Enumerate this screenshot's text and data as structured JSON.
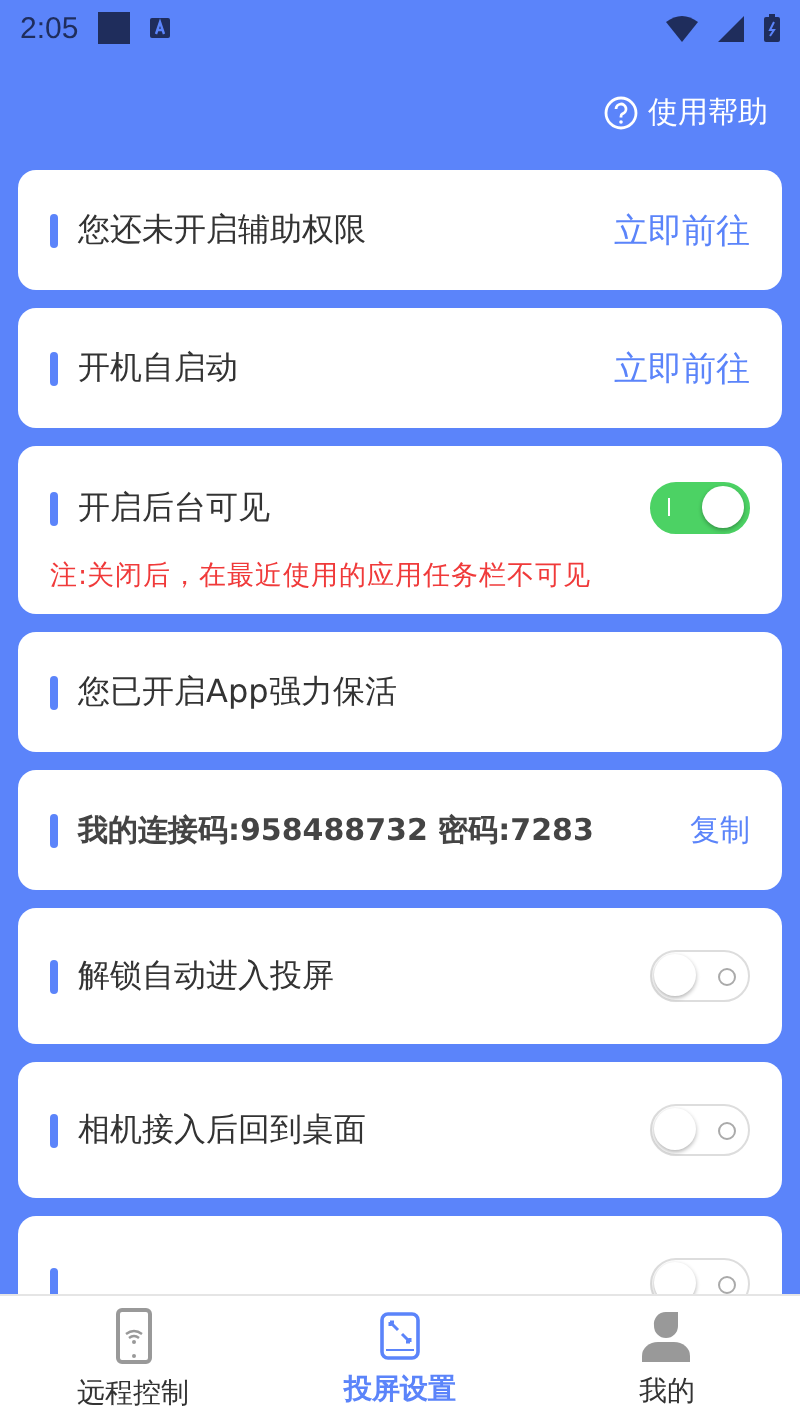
{
  "status_bar": {
    "time": "2:05"
  },
  "header": {
    "help": "使用帮助"
  },
  "items": [
    {
      "kind": "action",
      "label": "您还未开启辅助权限",
      "action": "立即前往"
    },
    {
      "kind": "action",
      "label": "开机自启动",
      "action": "立即前往"
    },
    {
      "kind": "toggle",
      "label": "开启后台可见",
      "on": true,
      "note": "注:关闭后，在最近使用的应用任务栏不可见"
    },
    {
      "kind": "info",
      "label": "您已开启App强力保活"
    },
    {
      "kind": "copy",
      "label": "我的连接码:958488732 密码:7283",
      "action": "复制"
    },
    {
      "kind": "toggle",
      "label": "解锁自动进入投屏",
      "on": false
    },
    {
      "kind": "toggle",
      "label": "相机接入后回到桌面",
      "on": false
    },
    {
      "kind": "toggle",
      "on": false
    }
  ],
  "nav": [
    {
      "label": "远程控制",
      "kind": "phone",
      "selected": false
    },
    {
      "label": "投屏设置",
      "kind": "screen",
      "selected": true
    },
    {
      "label": "我的",
      "kind": "person",
      "selected": false
    }
  ]
}
